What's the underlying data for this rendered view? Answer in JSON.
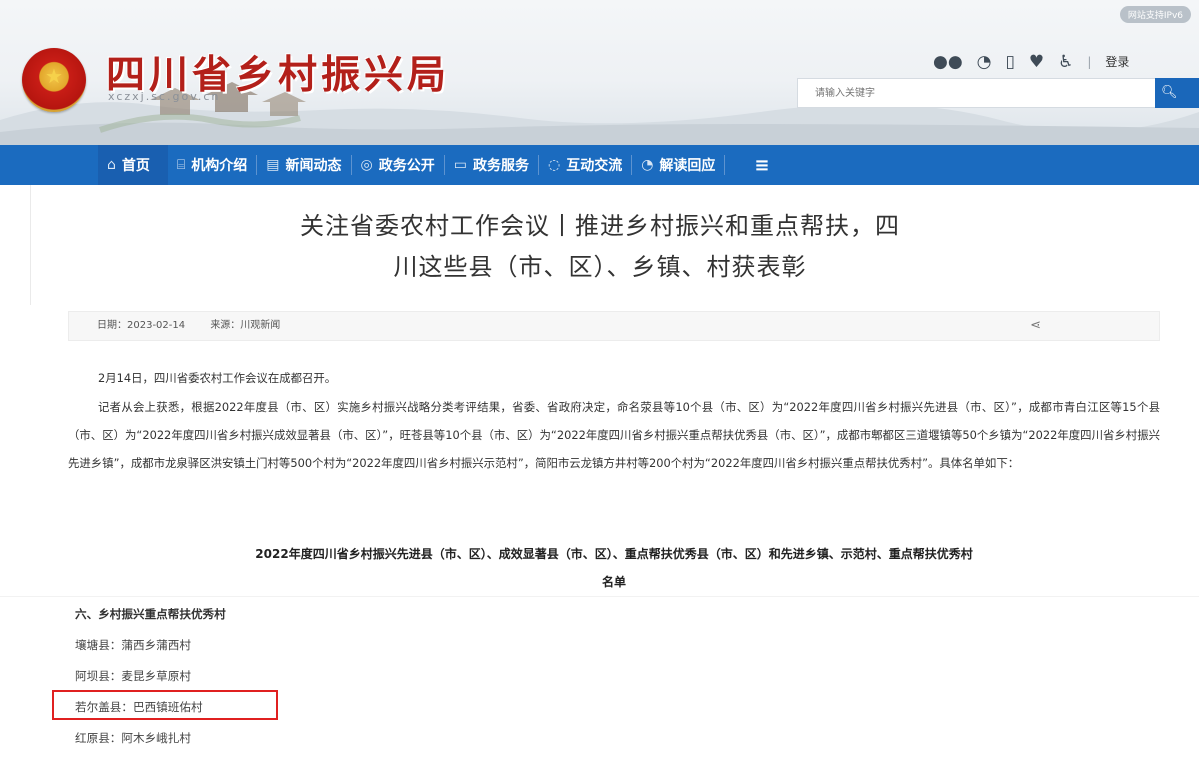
{
  "header": {
    "ipv6_badge": "网站支持IPv6",
    "site_title": "四川省乡村振兴局",
    "site_domain": "xczxj.sc.gov.cn",
    "login_label": "登录",
    "search": {
      "placeholder": "请输入关键字",
      "icon": "search-icon"
    },
    "tool_icons": [
      "wechat-icon",
      "weibo-icon",
      "mobile-icon",
      "heart-icon",
      "accessibility-icon"
    ]
  },
  "nav": {
    "items": [
      {
        "label": "首页",
        "icon": "home-icon"
      },
      {
        "label": "机构介绍",
        "icon": "institution-icon"
      },
      {
        "label": "新闻动态",
        "icon": "news-icon"
      },
      {
        "label": "政务公开",
        "icon": "broadcast-icon"
      },
      {
        "label": "政务服务",
        "icon": "service-icon"
      },
      {
        "label": "互动交流",
        "icon": "chat-icon"
      },
      {
        "label": "解读回应",
        "icon": "interpret-icon"
      }
    ],
    "menu_icon": "menu-icon"
  },
  "article": {
    "title_line1": "关注省委农村工作会议丨推进乡村振兴和重点帮扶，四",
    "title_line2": "川这些县（市、区）、乡镇、村获表彰",
    "date": "日期：2023-02-14",
    "source": "来源：川观新闻",
    "share_icon": "share-icon",
    "paragraph1": "2月14日，四川省委农村工作会议在成都召开。",
    "paragraph2": "记者从会上获悉，根据2022年度县（市、区）实施乡村振兴战略分类考评结果，省委、省政府决定，命名荥县等10个县（市、区）为“2022年度四川省乡村振兴先进县（市、区）”，成都市青白江区等15个县（市、区）为“2022年度四川省乡村振兴成效显著县（市、区）”，旺苍县等10个县（市、区）为“2022年度四川省乡村振兴重点帮扶优秀县（市、区）”，成都市郫都区三道堰镇等50个乡镇为“2022年度四川省乡村振兴先进乡镇”，成都市龙泉驿区洪安镇土门村等500个村为“2022年度四川省乡村振兴示范村”，简阳市云龙镇方井村等200个村为“2022年度四川省乡村振兴重点帮扶优秀村”。具体名单如下：",
    "list_title_line1": "2022年度四川省乡村振兴先进县（市、区）、成效显著县（市、区）、重点帮扶优秀县（市、区）和先进乡镇、示范村、重点帮扶优秀村",
    "list_title_line2": "名单",
    "section_heading": "六、乡村振兴重点帮扶优秀村",
    "villages": [
      "壤塘县：蒲西乡蒲西村",
      "阿坝县：麦昆乡草原村",
      "若尔盖县：巴西镇班佑村",
      "红原县：阿木乡峨扎村"
    ]
  },
  "colors": {
    "nav_blue": "#1b6bbf",
    "title_red": "#b3201a",
    "highlight_red": "#e02020"
  }
}
